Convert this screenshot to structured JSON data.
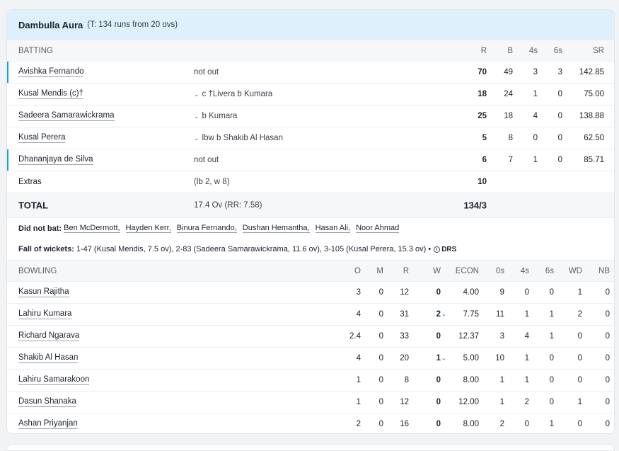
{
  "team": {
    "name": "Dambulla Aura",
    "target": "(T: 134 runs from 20 ovs)"
  },
  "batting": {
    "headers": {
      "title": "BATTING",
      "r": "R",
      "b": "B",
      "fours": "4s",
      "sixes": "6s",
      "sr": "SR"
    },
    "rows": [
      {
        "name": "Avishka Fernando",
        "dismissal": "not out",
        "r": "70",
        "b": "49",
        "fours": "3",
        "sixes": "3",
        "sr": "142.85",
        "not_out": true,
        "expandable": false
      },
      {
        "name": "Kusal Mendis (c)†",
        "dismissal": "c †Livera b Kumara",
        "r": "18",
        "b": "24",
        "fours": "1",
        "sixes": "0",
        "sr": "75.00",
        "not_out": false,
        "expandable": true
      },
      {
        "name": "Sadeera Samarawickrama",
        "dismissal": "b Kumara",
        "r": "25",
        "b": "18",
        "fours": "4",
        "sixes": "0",
        "sr": "138.88",
        "not_out": false,
        "expandable": true
      },
      {
        "name": "Kusal Perera",
        "dismissal": "lbw b Shakib Al Hasan",
        "r": "5",
        "b": "8",
        "fours": "0",
        "sixes": "0",
        "sr": "62.50",
        "not_out": false,
        "expandable": true
      },
      {
        "name": "Dhananjaya de Silva",
        "dismissal": "not out",
        "r": "6",
        "b": "7",
        "fours": "1",
        "sixes": "0",
        "sr": "85.71",
        "not_out": true,
        "expandable": false
      }
    ],
    "extras": {
      "label": "Extras",
      "detail": "(lb 2, w 8)",
      "value": "10"
    },
    "total": {
      "label": "TOTAL",
      "overs": "17.4 Ov (RR: 7.58)",
      "score": "134/3"
    }
  },
  "did_not_bat": {
    "label": "Did not bat:",
    "players": [
      "Ben McDermott,",
      "Hayden Kerr,",
      "Binura Fernando,",
      "Dushan Hemantha,",
      "Hasan Ali,",
      "Noor Ahmad"
    ]
  },
  "fall_of_wickets": {
    "label": "Fall of wickets:",
    "text": "1-47 (Kusal Mendis, 7.5 ov), 2-83 (Sadeera Samarawickrama, 11.6 ov), 3-105 (Kusal Perera, 15.3 ov) •",
    "drs": "DRS"
  },
  "bowling": {
    "headers": {
      "title": "BOWLING",
      "o": "O",
      "m": "M",
      "r": "R",
      "w": "W",
      "econ": "ECON",
      "zeros": "0s",
      "fours": "4s",
      "sixes": "6s",
      "wd": "WD",
      "nb": "NB"
    },
    "rows": [
      {
        "name": "Kasun Rajitha",
        "o": "3",
        "m": "0",
        "r": "12",
        "w": "0",
        "econ": "4.00",
        "zeros": "9",
        "fours": "0",
        "sixes": "0",
        "wd": "1",
        "nb": "0",
        "expandable": false
      },
      {
        "name": "Lahiru Kumara",
        "o": "4",
        "m": "0",
        "r": "31",
        "w": "2",
        "econ": "7.75",
        "zeros": "11",
        "fours": "1",
        "sixes": "1",
        "wd": "2",
        "nb": "0",
        "expandable": true
      },
      {
        "name": "Richard Ngarava",
        "o": "2.4",
        "m": "0",
        "r": "33",
        "w": "0",
        "econ": "12.37",
        "zeros": "3",
        "fours": "4",
        "sixes": "1",
        "wd": "0",
        "nb": "0",
        "expandable": false
      },
      {
        "name": "Shakib Al Hasan",
        "o": "4",
        "m": "0",
        "r": "20",
        "w": "1",
        "econ": "5.00",
        "zeros": "10",
        "fours": "1",
        "sixes": "0",
        "wd": "0",
        "nb": "0",
        "expandable": true
      },
      {
        "name": "Lahiru Samarakoon",
        "o": "1",
        "m": "0",
        "r": "8",
        "w": "0",
        "econ": "8.00",
        "zeros": "1",
        "fours": "1",
        "sixes": "0",
        "wd": "0",
        "nb": "0",
        "expandable": false
      },
      {
        "name": "Dasun Shanaka",
        "o": "1",
        "m": "0",
        "r": "12",
        "w": "0",
        "econ": "12.00",
        "zeros": "1",
        "fours": "2",
        "sixes": "0",
        "wd": "1",
        "nb": "0",
        "expandable": false
      },
      {
        "name": "Ashan Priyanjan",
        "o": "2",
        "m": "0",
        "r": "16",
        "w": "0",
        "econ": "8.00",
        "zeros": "2",
        "fours": "0",
        "sixes": "1",
        "wd": "0",
        "nb": "0",
        "expandable": false
      }
    ]
  },
  "colors": {
    "header_bg": "#ddf0fb",
    "accent": "#1a9fe0",
    "row_head_bg": "#f6f7f8"
  }
}
